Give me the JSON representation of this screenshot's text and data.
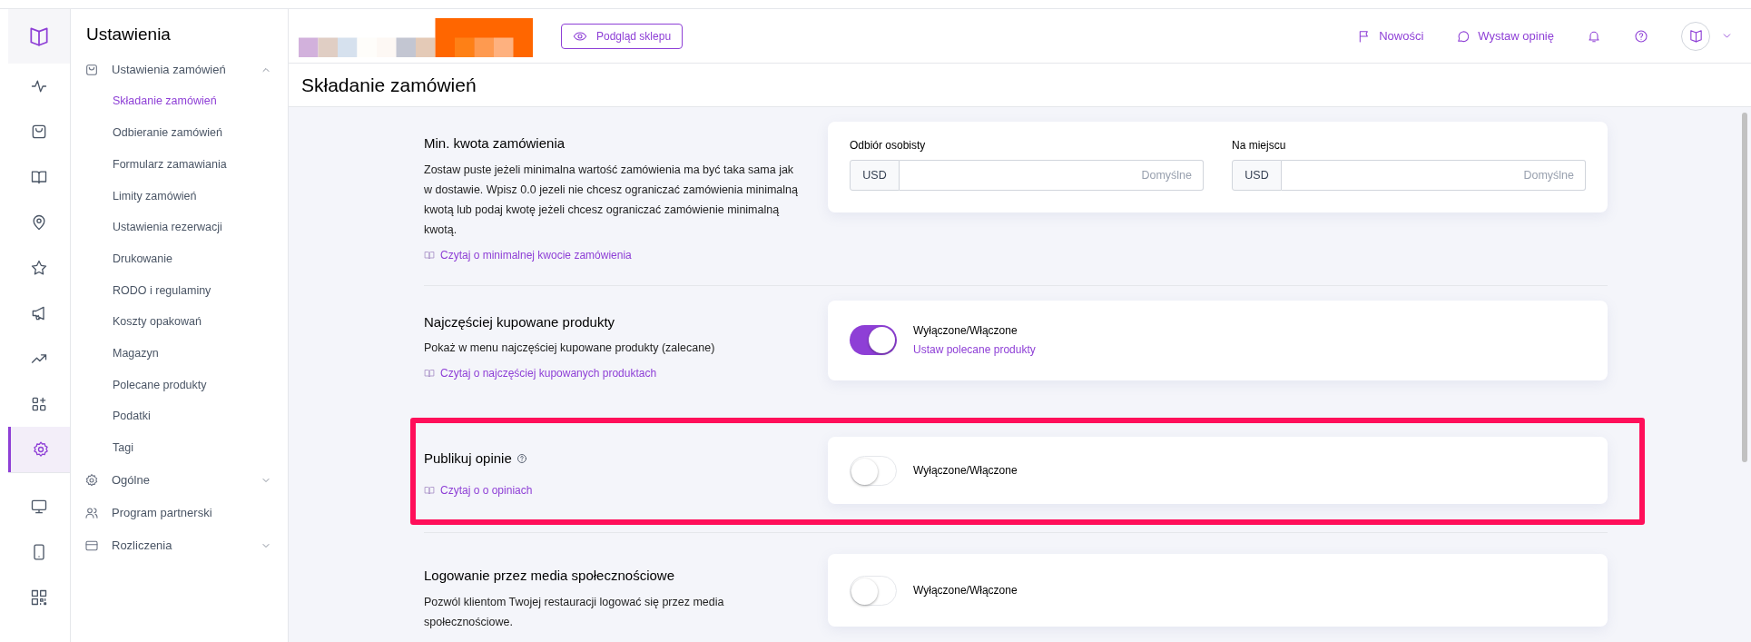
{
  "rail": [
    {
      "selected": false
    },
    {
      "selected": false
    },
    {
      "selected": false
    },
    {
      "selected": false
    },
    {
      "selected": false
    },
    {
      "selected": false
    },
    {
      "selected": false
    },
    {
      "selected": false
    },
    {
      "selected": false
    },
    {
      "selected": true
    },
    {
      "selected": false
    },
    {
      "selected": false
    },
    {
      "selected": false
    }
  ],
  "sidebar": {
    "title": "Ustawienia",
    "groups": [
      {
        "label": "Ustawienia zamówień",
        "expanded": true,
        "children": [
          {
            "label": "Składanie zamówień",
            "selected": true
          },
          {
            "label": "Odbieranie zamówień",
            "selected": false
          },
          {
            "label": "Formularz zamawiania",
            "selected": false
          },
          {
            "label": "Limity zamówień",
            "selected": false
          },
          {
            "label": "Ustawienia rezerwacji",
            "selected": false
          },
          {
            "label": "Drukowanie",
            "selected": false
          },
          {
            "label": "RODO i regulaminy",
            "selected": false
          },
          {
            "label": "Koszty opakowań",
            "selected": false
          },
          {
            "label": "Magazyn",
            "selected": false
          },
          {
            "label": "Polecane produkty",
            "selected": false
          },
          {
            "label": "Podatki",
            "selected": false
          },
          {
            "label": "Tagi",
            "selected": false
          }
        ]
      },
      {
        "label": "Ogólne",
        "expanded": false
      },
      {
        "label": "Program partnerski"
      },
      {
        "label": "Rozliczenia",
        "expanded": false
      }
    ]
  },
  "topbar": {
    "preview_button": "Podgląd sklepu",
    "links": [
      {
        "label": "Nowości"
      },
      {
        "label": "Wystaw opinię"
      }
    ]
  },
  "page_title": "Składanie zamówień",
  "settings": [
    {
      "kind": "amount",
      "title": "Min. kwota zamówienia",
      "description": "Zostaw puste jeżeli minimalna wartość zamówienia ma być taka sama jak w dostawie. Wpisz 0.0 jezeli nie chcesz ograniczać zamówienia minimalną kwotą lub podaj kwotę jeżeli chcesz ograniczać zamówienie minimalną kwotą.",
      "link": "Czytaj o minimalnej kwocie zamówienia",
      "highlighted": false,
      "fields": [
        {
          "label": "Odbiór osobisty",
          "prefix": "USD",
          "placeholder": "Domyślne"
        },
        {
          "label": "Na miejscu",
          "prefix": "USD",
          "placeholder": "Domyślne"
        }
      ]
    },
    {
      "kind": "toggle",
      "title": "Najczęściej kupowane produkty",
      "description": "Pokaż w menu najczęściej kupowane produkty (zalecane)",
      "link": "Czytaj o najczęściej kupowanych produktach",
      "highlighted": false,
      "toggle": {
        "on": true,
        "label": "Wyłączone/Włączone",
        "link": "Ustaw polecane produkty"
      }
    },
    {
      "kind": "toggle",
      "title": "Publikuj opinie",
      "help": true,
      "link": "Czytaj o o opiniach",
      "highlighted": true,
      "toggle": {
        "on": false,
        "label": "Wyłączone/Włączone"
      }
    },
    {
      "kind": "toggle",
      "title": "Logowanie przez media społecznościowe",
      "description": "Pozwól klientom Twojej restauracji logować się przez media społecznościowe.",
      "highlighted": false,
      "toggle": {
        "on": false,
        "label": "Wyłączone/Włączone"
      }
    }
  ]
}
